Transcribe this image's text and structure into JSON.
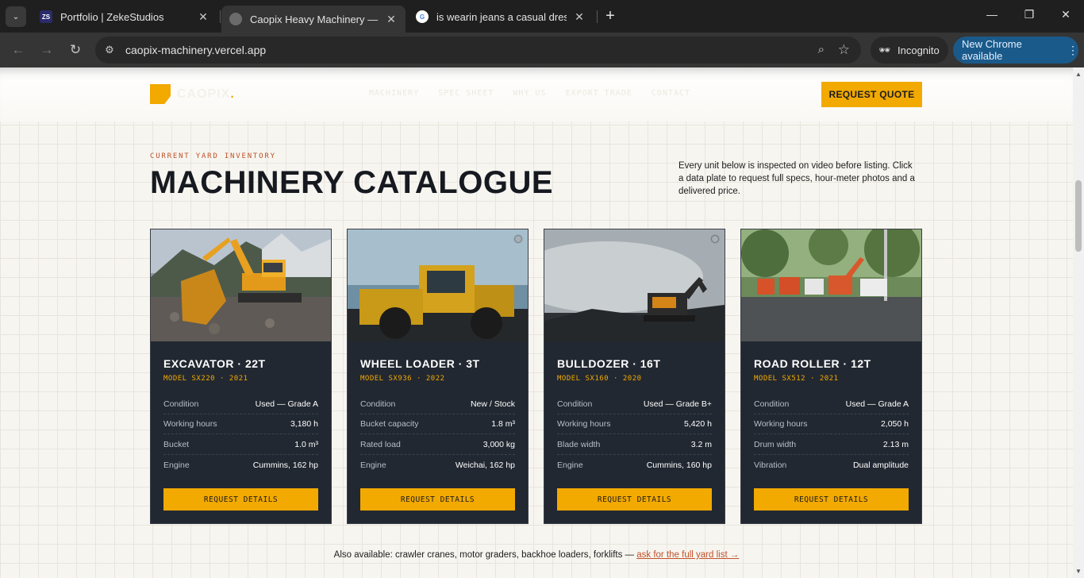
{
  "browser": {
    "tabs": [
      {
        "title": "Portfolio | ZekeStudios",
        "favicon_text": "ZS",
        "active": false
      },
      {
        "title": "Caopix Heavy Machinery — Cor",
        "active": true
      },
      {
        "title": "is wearin jeans a casual dressing",
        "active": false
      }
    ],
    "url": "caopix-machinery.vercel.app",
    "incognito_label": "Incognito",
    "update_label": "New Chrome available"
  },
  "site": {
    "brand": "CAOPIX",
    "brand_dot": ".",
    "nav": [
      "MACHINERY",
      "SPEC SHEET",
      "WHY US",
      "EXPORT TRADE",
      "CONTACT"
    ],
    "quote_button": "REQUEST QUOTE",
    "eyebrow": "CURRENT YARD INVENTORY",
    "title": "MACHINERY CATALOGUE",
    "intro": "Every unit below is inspected on video before listing. Click a data plate to request full specs, hour-meter photos and a delivered price.",
    "cards": [
      {
        "name": "EXCAVATOR · 22T",
        "model": "MODEL SX220 · 2021",
        "specs": [
          {
            "label": "Condition",
            "value": "Used — Grade A"
          },
          {
            "label": "Working hours",
            "value": "3,180 h"
          },
          {
            "label": "Bucket",
            "value": "1.0 m³"
          },
          {
            "label": "Engine",
            "value": "Cummins, 162 hp"
          }
        ],
        "button": "REQUEST DETAILS"
      },
      {
        "name": "WHEEL LOADER · 3T",
        "model": "MODEL SX936 · 2022",
        "specs": [
          {
            "label": "Condition",
            "value": "New / Stock"
          },
          {
            "label": "Bucket capacity",
            "value": "1.8 m³"
          },
          {
            "label": "Rated load",
            "value": "3,000 kg"
          },
          {
            "label": "Engine",
            "value": "Weichai, 162 hp"
          }
        ],
        "button": "REQUEST DETAILS"
      },
      {
        "name": "BULLDOZER · 16T",
        "model": "MODEL SX160 · 2020",
        "specs": [
          {
            "label": "Condition",
            "value": "Used — Grade B+"
          },
          {
            "label": "Working hours",
            "value": "5,420 h"
          },
          {
            "label": "Blade width",
            "value": "3.2 m"
          },
          {
            "label": "Engine",
            "value": "Cummins, 160 hp"
          }
        ],
        "button": "REQUEST DETAILS"
      },
      {
        "name": "ROAD ROLLER · 12T",
        "model": "MODEL SX512 · 2021",
        "specs": [
          {
            "label": "Condition",
            "value": "Used — Grade A"
          },
          {
            "label": "Working hours",
            "value": "2,050 h"
          },
          {
            "label": "Drum width",
            "value": "2.13 m"
          },
          {
            "label": "Vibration",
            "value": "Dual amplitude"
          }
        ],
        "button": "REQUEST DETAILS"
      }
    ],
    "also_text": "Also available: crawler cranes, motor graders, backhoe loaders, forklifts — ",
    "also_link": "ask for the full yard list →"
  },
  "colors": {
    "accent": "#f2a900",
    "card_bg": "#222831",
    "rust": "#c0522a",
    "chrome_dark": "#1f1f1f"
  }
}
